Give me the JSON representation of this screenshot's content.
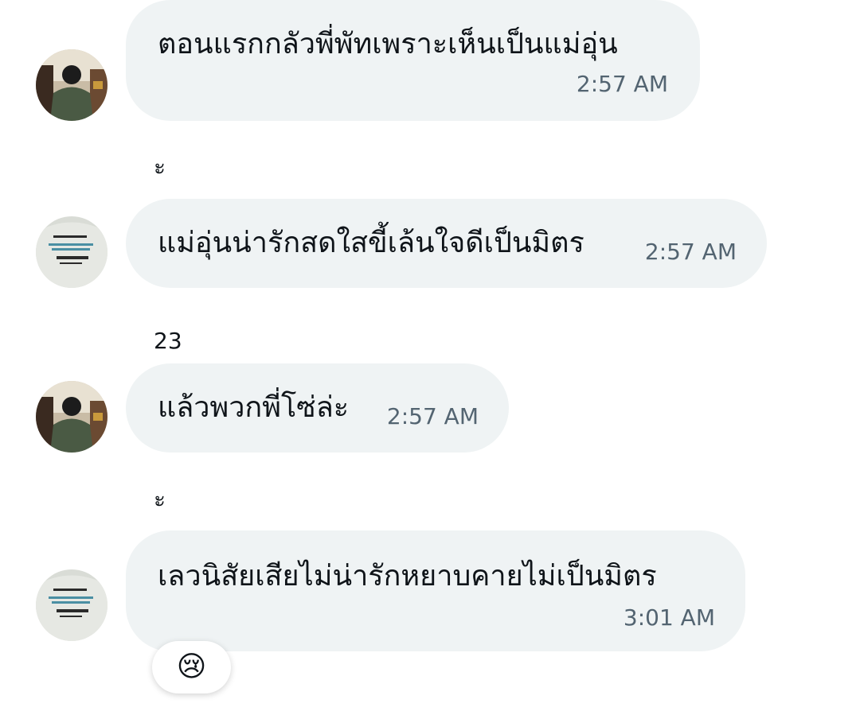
{
  "messages": [
    {
      "text": "ตอนแรกกลัวพี่พัทเพราะเห็นเป็นแม่อุ่น",
      "time": "2:57 AM",
      "avatar_icon": "user-avatar-photo-dark"
    },
    {
      "sender_label": "ะ",
      "text": "แม่อุ่นน่ารักสดใสขี้เล้นใจดีเป็นมิตร",
      "time": "2:57 AM",
      "avatar_icon": "user-avatar-photo-shirt"
    },
    {
      "sender_label": "23",
      "text": "แล้วพวกพี่โซ่ล่ะ",
      "time": "2:57 AM",
      "avatar_icon": "user-avatar-photo-dark"
    },
    {
      "sender_label": "ะ",
      "text": "เลวนิสัยเสียไม่น่ารักหยาบคายไม่เป็นมิตร",
      "time": "3:01 AM",
      "avatar_icon": "user-avatar-photo-shirt",
      "reaction": "😢",
      "reaction_icon": "crying-face-emoji"
    }
  ],
  "colors": {
    "bubble": "#eff3f4",
    "text": "#0f1419",
    "timestamp": "#536471"
  }
}
